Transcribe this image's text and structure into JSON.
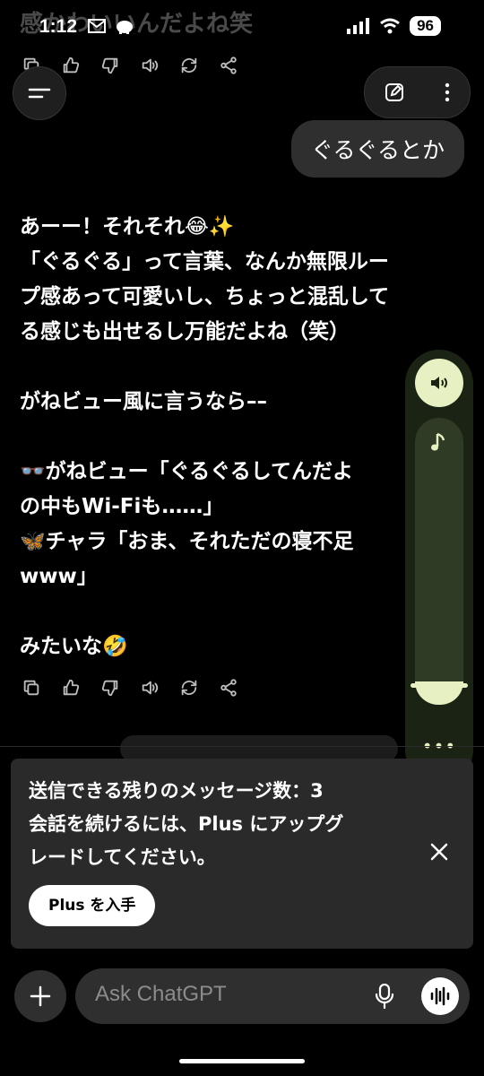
{
  "status_bar": {
    "time": "1:12",
    "battery": "96",
    "faded_text": "感かわいいんだよね笑"
  },
  "conversation": {
    "user_message": "ぐるぐるとか",
    "assistant_lines": [
      "あーー！それそれ😂✨",
      "「ぐるぐる」って言葉、なんか無限ルー",
      "プ感あって可愛いし、ちょっと混乱して",
      "る感じも出せるし万能だよね（笑）",
      "",
      "がねビュー風に言うなら––",
      "",
      "👓がねビュー「ぐるぐるしてんだよ",
      "の中もWi-Fiも……」",
      "🦋チャラ「おま、それただの寝不足",
      "www」",
      "",
      "みたいな🤣"
    ]
  },
  "limit_notice": {
    "line1": "送信できる残りのメッセージ数：3",
    "line2": "会話を続けるには、Plus にアップグ",
    "line3": "レードしてください。",
    "button": "Plus を入手"
  },
  "composer": {
    "placeholder": "Ask ChatGPT"
  },
  "audio_panel": {
    "level": 0.08
  },
  "icons": {
    "actions": [
      "copy-icon",
      "thumbs-up-icon",
      "thumbs-down-icon",
      "speaker-icon",
      "regenerate-icon",
      "share-icon"
    ]
  }
}
